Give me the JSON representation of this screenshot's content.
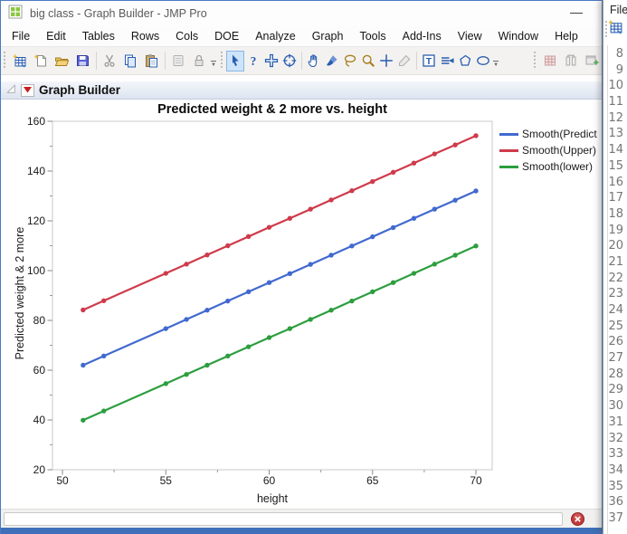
{
  "window": {
    "title": "big class - Graph Builder - JMP Pro",
    "app_icon": "jmp-table-icon",
    "minimize_glyph": "—"
  },
  "menu_bar": {
    "items": [
      "File",
      "Edit",
      "Tables",
      "Rows",
      "Cols",
      "DOE",
      "Analyze",
      "Graph",
      "Tools",
      "Add-Ins",
      "View",
      "Window",
      "Help"
    ]
  },
  "toolbar": {
    "file_group": [
      {
        "name": "new-data-table-icon"
      },
      {
        "name": "new-script-icon"
      },
      {
        "name": "open-icon"
      },
      {
        "name": "save-icon"
      },
      {
        "name": "cut-icon",
        "disabled": true
      },
      {
        "name": "copy-icon"
      },
      {
        "name": "paste-icon"
      },
      {
        "name": "journal-icon",
        "disabled": true
      },
      {
        "name": "lock-icon",
        "disabled": true
      }
    ],
    "tools_group": [
      {
        "name": "arrow-tool-icon",
        "selected": true
      },
      {
        "name": "help-tool-icon"
      },
      {
        "name": "move-tool-icon"
      },
      {
        "name": "target-tool-icon"
      },
      {
        "name": "hand-tool-icon"
      },
      {
        "name": "brush-tool-icon"
      },
      {
        "name": "lasso-tool-icon"
      },
      {
        "name": "magnifier-tool-icon"
      },
      {
        "name": "crosshair-tool-icon"
      },
      {
        "name": "eraser-tool-icon",
        "disabled": true
      },
      {
        "name": "text-annotate-tool-icon"
      },
      {
        "name": "arrow-annotate-tool-icon"
      },
      {
        "name": "polygon-tool-icon"
      },
      {
        "name": "oval-tool-icon"
      }
    ],
    "report_group": [
      {
        "name": "data-table-icon",
        "disabled": true
      },
      {
        "name": "join-columns-icon",
        "disabled": true
      },
      {
        "name": "add-window-icon",
        "disabled": true
      }
    ]
  },
  "report": {
    "outline_title": "Graph Builder"
  },
  "chart_data": {
    "type": "line",
    "title": "Predicted weight & 2 more vs. height",
    "xlabel": "height",
    "ylabel": "Predicted weight & 2 more",
    "xlim": [
      50,
      70
    ],
    "ylim": [
      20,
      160
    ],
    "x_ticks": [
      50,
      55,
      60,
      65,
      70
    ],
    "y_ticks": [
      20,
      40,
      60,
      80,
      100,
      120,
      140,
      160
    ],
    "grid": false,
    "legend_position": "right",
    "marker": "circle",
    "x": [
      51,
      52,
      55,
      56,
      57,
      58,
      59,
      60,
      61,
      62,
      63,
      64,
      65,
      66,
      67,
      68,
      69,
      70
    ],
    "series": [
      {
        "legend_label": "Smooth(Predict",
        "color": "#4169cf",
        "values": [
          62.0,
          65.7,
          76.7,
          80.4,
          84.1,
          87.8,
          91.5,
          95.2,
          98.8,
          102.5,
          106.2,
          109.9,
          113.6,
          117.3,
          121.0,
          124.7,
          128.3,
          132.0
        ]
      },
      {
        "legend_label": "Smooth(Upper)",
        "color": "#cf3a4a",
        "values": [
          84.2,
          87.9,
          98.9,
          102.6,
          106.3,
          110.0,
          113.7,
          117.4,
          121.0,
          124.7,
          128.4,
          132.1,
          135.8,
          139.5,
          143.2,
          146.9,
          150.5,
          154.2
        ]
      },
      {
        "legend_label": "Smooth(lower)",
        "color": "#2c9e3e",
        "values": [
          39.9,
          43.6,
          54.6,
          58.3,
          62.0,
          65.7,
          69.4,
          73.1,
          76.7,
          80.4,
          84.1,
          87.8,
          91.5,
          95.2,
          98.9,
          102.6,
          106.2,
          109.9
        ]
      }
    ]
  },
  "status_bar": {
    "alert_icon": "red-circle-x-icon"
  },
  "side_window": {
    "menu_label": "File",
    "toolbar_icon": "new-data-table-icon",
    "row_numbers": [
      8,
      9,
      10,
      11,
      12,
      13,
      14,
      15,
      16,
      17,
      18,
      19,
      20,
      21,
      22,
      23,
      24,
      25,
      26,
      27,
      28,
      29,
      30,
      31,
      32,
      33,
      34,
      35,
      36,
      37
    ]
  }
}
